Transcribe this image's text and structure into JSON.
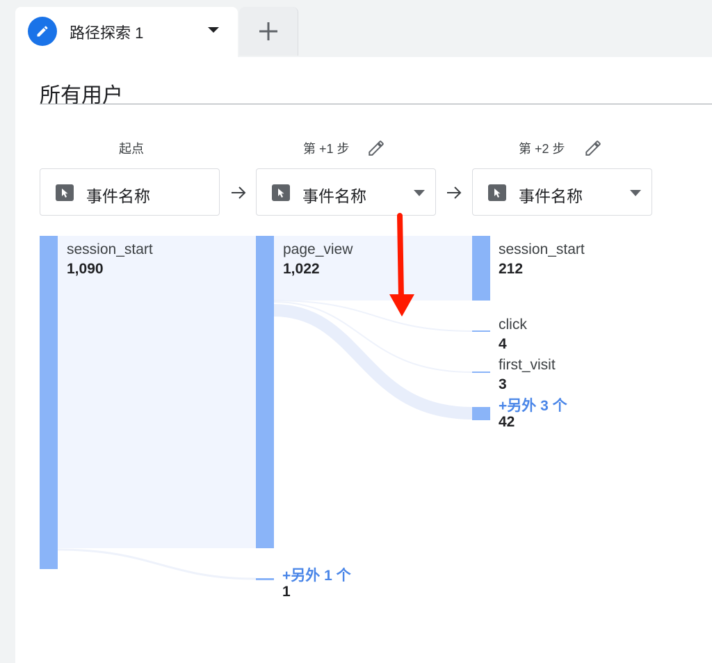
{
  "tab": {
    "title": "路径探索 1",
    "icon": "pencil-icon"
  },
  "segment": {
    "title": "所有用户"
  },
  "steps": [
    {
      "label": "起点",
      "node": "事件名称"
    },
    {
      "label": "第 +1 步",
      "node": "事件名称"
    },
    {
      "label": "第 +2 步",
      "node": "事件名称"
    }
  ],
  "flow": {
    "col0": [
      {
        "name": "session_start",
        "value": "1,090"
      }
    ],
    "col1": [
      {
        "name": "page_view",
        "value": "1,022"
      },
      {
        "name": "+另外 1 个",
        "value": "1"
      }
    ],
    "col2": [
      {
        "name": "session_start",
        "value": "212"
      },
      {
        "name": "click",
        "value": "4"
      },
      {
        "name": "first_visit",
        "value": "3"
      },
      {
        "name": "+另外 3 个",
        "value": "42"
      }
    ]
  },
  "colors": {
    "accent": "#1a73e8",
    "node_bar": "#8ab4f8",
    "node_fill": "#f1f5fe",
    "link": "#e8eefb",
    "more_link": "#4a86e8",
    "annotation_arrow": "#ff1a00"
  }
}
